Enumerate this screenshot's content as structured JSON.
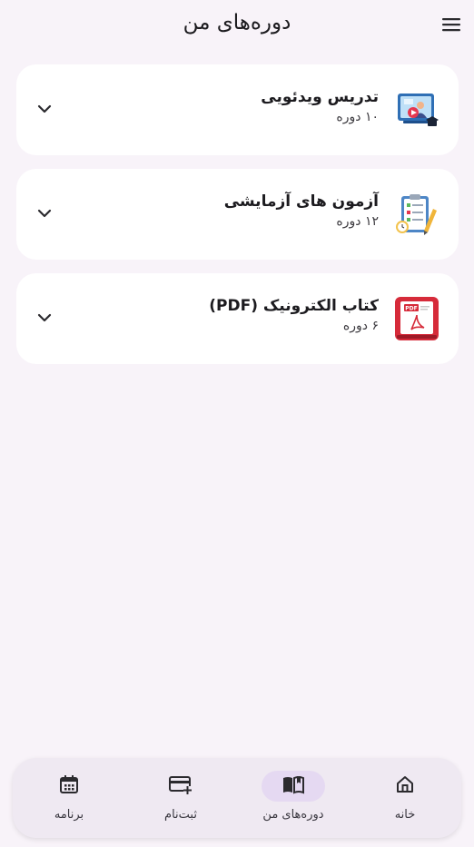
{
  "header": {
    "title": "دوره‌های من",
    "menu_icon": "hamburger-menu-icon"
  },
  "courses": [
    {
      "title": "تدریس ویدئویی",
      "subtitle": "۱۰ دوره",
      "icon": "video-lesson-icon"
    },
    {
      "title": "آزمون های آزمایشی",
      "subtitle": "۱۲ دوره",
      "icon": "quiz-checklist-icon"
    },
    {
      "title": "کتاب الکترونیک (PDF)",
      "subtitle": "۶ دوره",
      "icon": "pdf-book-icon"
    }
  ],
  "bottom_nav": {
    "items": [
      {
        "label": "برنامه",
        "icon": "calendar-icon",
        "active": false
      },
      {
        "label": "ثبت‌نام",
        "icon": "card-add-icon",
        "active": false
      },
      {
        "label": "دوره‌های من",
        "icon": "open-book-icon",
        "active": true
      },
      {
        "label": "خانه",
        "icon": "home-icon",
        "active": false
      }
    ]
  },
  "colors": {
    "background": "#f8f3f9",
    "card": "#ffffff",
    "nav_background": "#efe9f2",
    "nav_active_pill": "#e5d9f2",
    "text": "#1c1b1f"
  }
}
